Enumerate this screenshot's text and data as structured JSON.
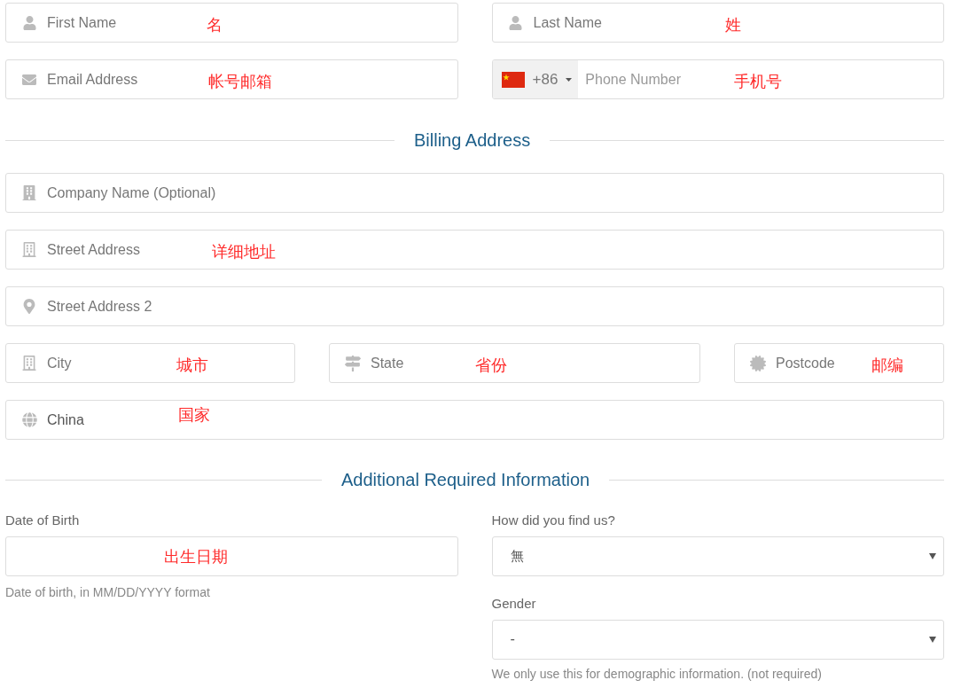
{
  "contact_fields": [
    {
      "kind": "text",
      "placeholder": "First Name",
      "annotation": "名"
    },
    {
      "kind": "text",
      "placeholder": "Last Name",
      "annotation": "姓"
    },
    {
      "kind": "text",
      "placeholder": "Email Address",
      "annotation": "帐号邮箱"
    },
    {
      "kind": "phone",
      "country_code": "+86",
      "placeholder": "Phone Number",
      "annotation": "手机号"
    }
  ],
  "billing_heading": "Billing Address",
  "billing_fields": [
    {
      "placeholder": "Company Name (Optional)"
    },
    {
      "placeholder": "Street Address",
      "annotation": "详细地址"
    },
    {
      "placeholder": "Street Address 2"
    },
    {
      "placeholder": "City",
      "annotation": "城市"
    },
    {
      "placeholder": "State",
      "annotation": "省份"
    },
    {
      "placeholder": "Postcode",
      "annotation": "邮编"
    },
    {
      "value": "China",
      "annotation": "国家"
    }
  ],
  "additional_heading": "Additional Required Information",
  "date_of_birth": {
    "label": "Date of Birth",
    "annotation": "出生日期",
    "help": "Date of birth, in MM/DD/YYYY format"
  },
  "find_us": {
    "label": "How did you find us?",
    "value": "無"
  },
  "gender": {
    "label": "Gender",
    "value": "-",
    "help": "We only use this for demographic information. (not required)"
  }
}
